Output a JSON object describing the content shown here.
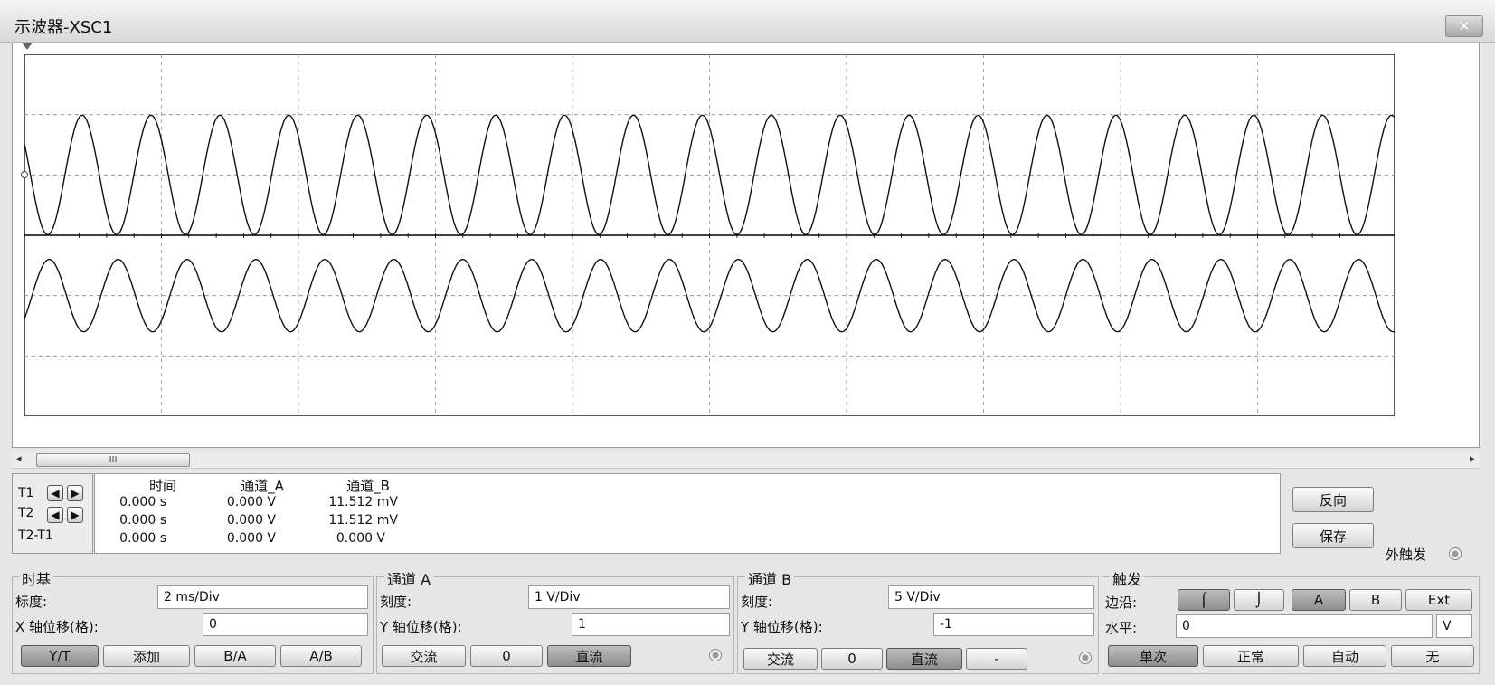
{
  "window": {
    "title": "示波器-XSC1",
    "close_label": "✕"
  },
  "scope": {
    "timebase": "2 ms/Div",
    "channel_a": {
      "scale": "1 V/Div",
      "y_position_div": 1,
      "color": "#000000"
    },
    "channel_b": {
      "scale": "5 V/Div",
      "y_position_div": -1,
      "color": "#000000"
    }
  },
  "scrollbar": {
    "thumb_label": "III",
    "left_arrow": "◂",
    "right_arrow": "▸"
  },
  "cursors": {
    "labels": [
      "T1",
      "T2",
      "T2-T1"
    ],
    "headers": [
      "时间",
      "通道_A",
      "通道_B"
    ],
    "rows": [
      [
        "0.000 s",
        "0.000 V",
        "11.512 mV"
      ],
      [
        "0.000 s",
        "0.000 V",
        "11.512 mV"
      ],
      [
        "0.000 s",
        "0.000 V",
        "0.000 V"
      ]
    ],
    "arrow_left": "◀",
    "arrow_right": "▶"
  },
  "side_buttons": {
    "reverse": "反向",
    "save": "保存",
    "ext_trigger": "外触发"
  },
  "timebase_group": {
    "title": "时基",
    "scale_label": "标度:",
    "scale_value": "2 ms/Div",
    "xpos_label": "X 轴位移(格):",
    "xpos_value": "0",
    "buttons": [
      "Y/T",
      "添加",
      "B/A",
      "A/B"
    ]
  },
  "channel_a_group": {
    "title": "通道 A",
    "scale_label": "刻度:",
    "scale_value": "1 V/Div",
    "ypos_label": "Y 轴位移(格):",
    "ypos_value": "1",
    "buttons": [
      "交流",
      "0",
      "直流"
    ]
  },
  "channel_b_group": {
    "title": "通道 B",
    "scale_label": "刻度:",
    "scale_value": "5 V/Div",
    "ypos_label": "Y 轴位移(格):",
    "ypos_value": "-1",
    "buttons": [
      "交流",
      "0",
      "直流",
      "-"
    ]
  },
  "trigger_group": {
    "title": "触发",
    "edge_label": "边沿:",
    "edge_buttons": [
      "⌠",
      "⌡",
      "A",
      "B",
      "Ext"
    ],
    "level_label": "水平:",
    "level_value": "0",
    "level_unit": "V",
    "mode_buttons": [
      "单次",
      "正常",
      "自动",
      "无"
    ]
  }
}
